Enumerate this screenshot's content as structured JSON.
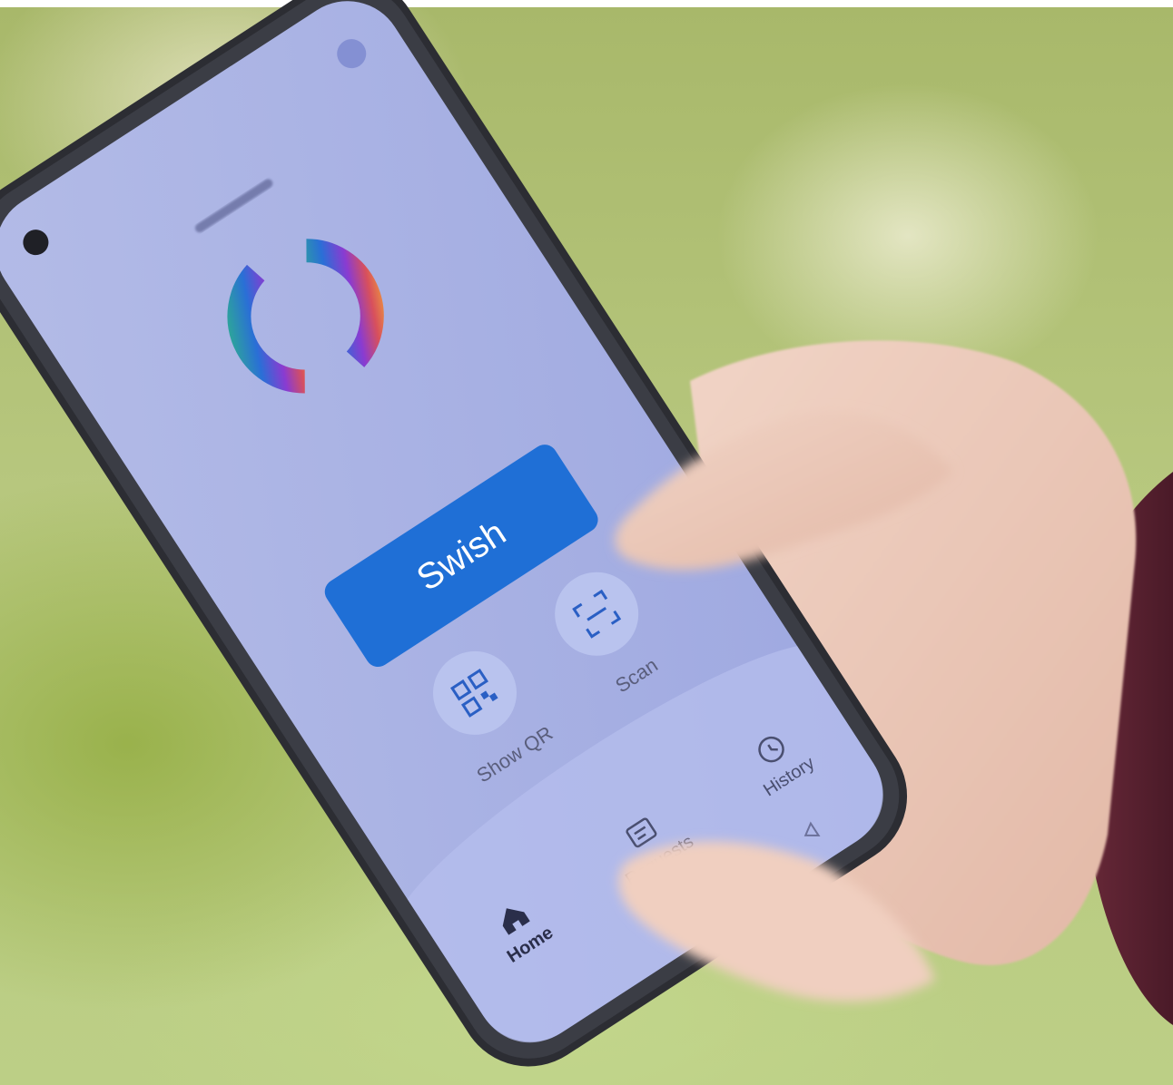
{
  "app": {
    "primary_action": "Swish",
    "actions": [
      {
        "label": "Show QR",
        "icon": "qr-code-icon"
      },
      {
        "label": "Scan",
        "icon": "scan-icon"
      }
    ],
    "nav": [
      {
        "label": "Home",
        "icon": "home-icon"
      },
      {
        "label": "Requests",
        "icon": "requests-icon"
      },
      {
        "label": "History",
        "icon": "history-icon"
      }
    ]
  },
  "colors": {
    "button_primary": "#1f6fd6",
    "screen_background": "#a7b2e6",
    "action_circle": "#b9c3ee",
    "phone_frame": "#2c2d33"
  }
}
